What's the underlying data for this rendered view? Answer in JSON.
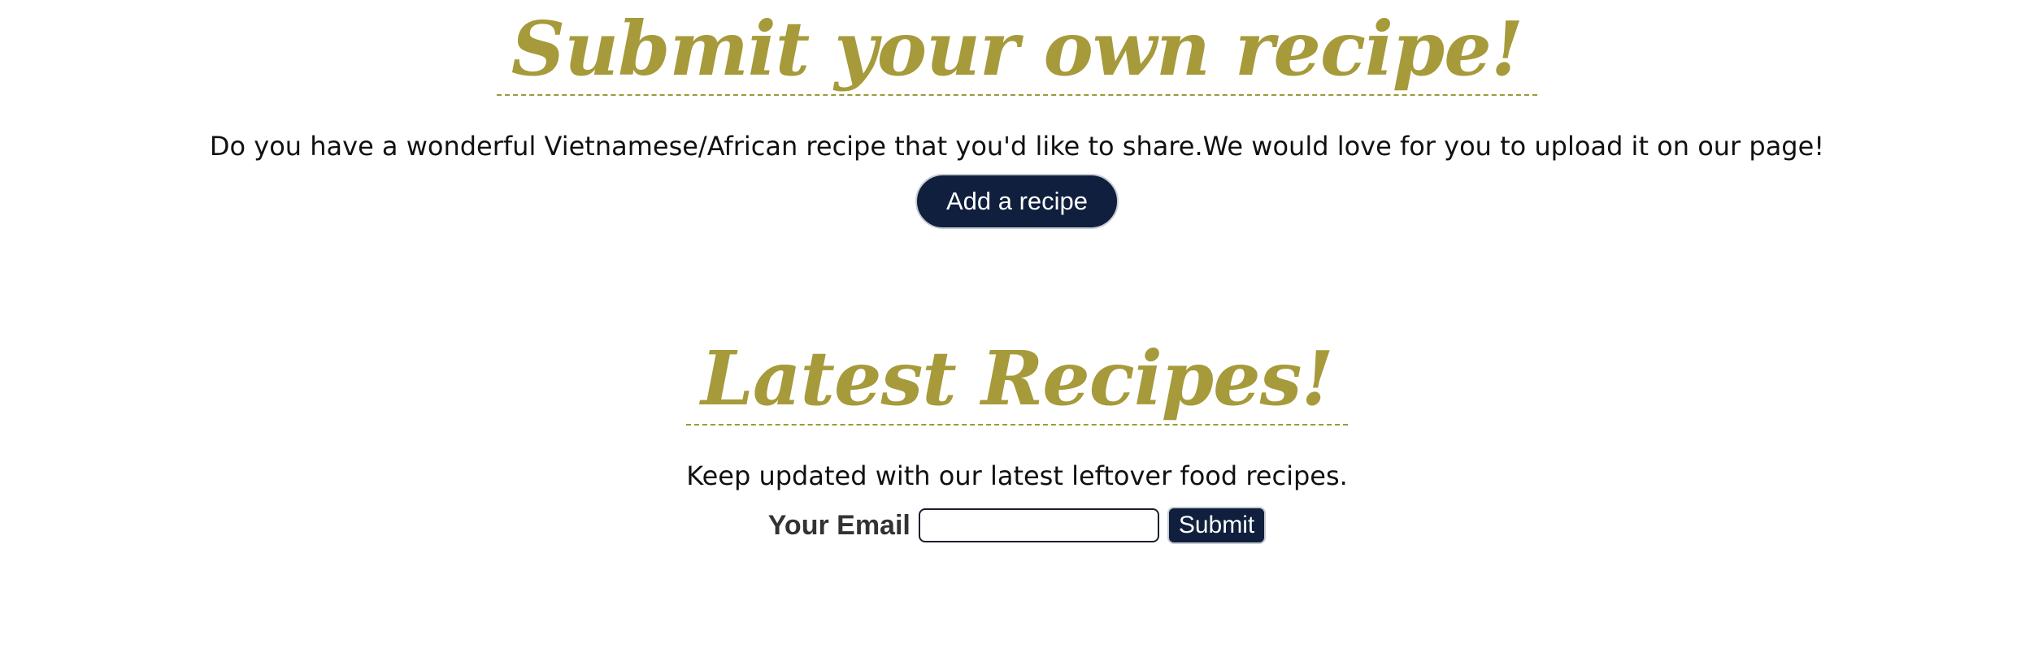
{
  "submit_section": {
    "heading": "Submit your own recipe!",
    "description": "Do you have a wonderful Vietnamese/African recipe that you'd like to share.We would love for you to upload it on our page!",
    "add_button_label": "Add a recipe"
  },
  "latest_section": {
    "heading": "Latest Recipes!",
    "description": "Keep updated with our latest leftover food recipes.",
    "email_label": "Your Email",
    "email_value": "",
    "email_placeholder": "",
    "submit_label": "Submit"
  },
  "colors": {
    "heading": "#a69a3b",
    "button_bg": "#0f1f3d",
    "dashed_rule": "#9a9a3a"
  }
}
